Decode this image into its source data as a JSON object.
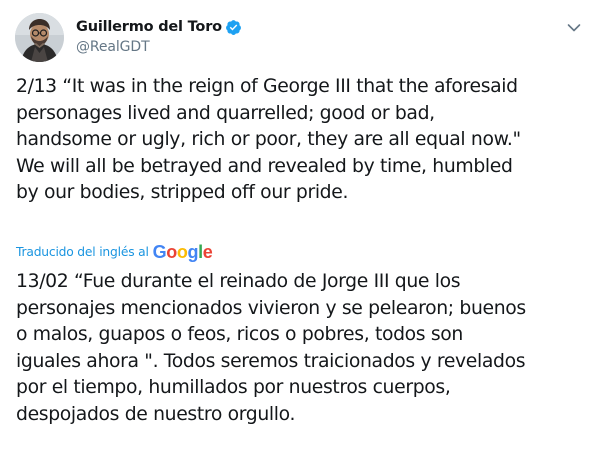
{
  "author": {
    "display_name": "Guillermo del Toro",
    "handle": "@RealGDT",
    "verified": true,
    "avatar_icon": "avatar-portrait",
    "verified_icon": "verified-badge-icon",
    "menu_icon": "chevron-down-icon"
  },
  "tweet": {
    "text": "2/13 “It was in the reign of George III that the aforesaid\npersonages lived and quarrelled; good or bad,\nhandsome or ugly, rich or poor, they are all equal now.\"\nWe will all be betrayed and revealed by time, humbled\nby our bodies, stripped off our pride."
  },
  "translation": {
    "label": "Traducido del inglés al",
    "provider_letters": [
      "G",
      "o",
      "o",
      "g",
      "l",
      "e"
    ],
    "provider_colors": [
      "#4285f4",
      "#ea4335",
      "#fbbc05",
      "#4285f4",
      "#34a853",
      "#ea4335"
    ],
    "text": "13/02 “Fue durante el reinado de Jorge III que los\npersonajes mencionados vivieron y se pelearon; buenos\no malos, guapos o feos, ricos o pobres, todos son\niguales ahora \". Todos seremos traicionados y revelados\npor el tiempo, humillados por nuestros cuerpos,\ndespojados de nuestro orgullo."
  },
  "colors": {
    "text": "#14171a",
    "secondary": "#657786",
    "accent": "#1b95e0"
  }
}
